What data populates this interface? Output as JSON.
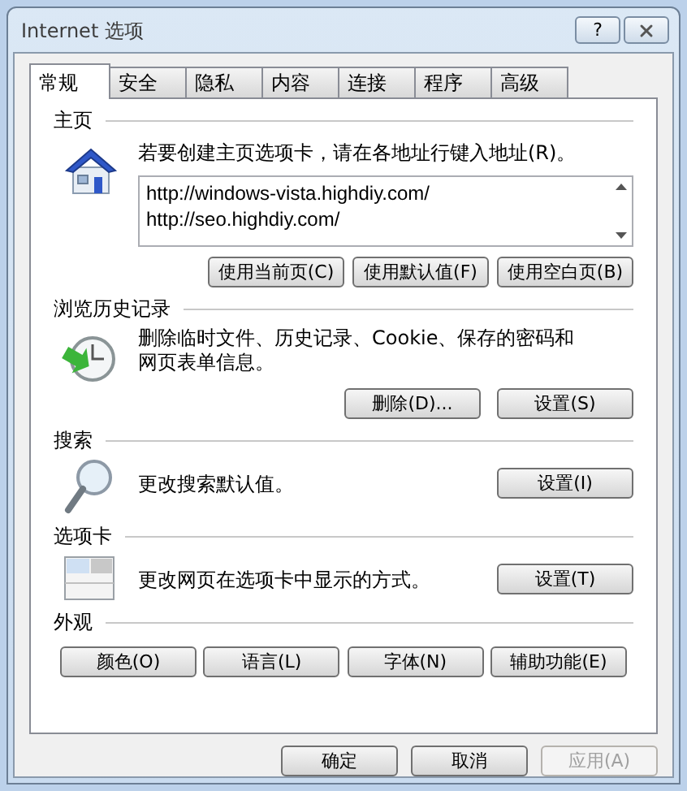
{
  "window": {
    "title": "Internet 选项",
    "help_button": "?"
  },
  "tabs": [
    {
      "label": "常规",
      "selected": true
    },
    {
      "label": "安全",
      "selected": false
    },
    {
      "label": "隐私",
      "selected": false
    },
    {
      "label": "内容",
      "selected": false
    },
    {
      "label": "连接",
      "selected": false
    },
    {
      "label": "程序",
      "selected": false
    },
    {
      "label": "高级",
      "selected": false
    }
  ],
  "sections": [
    {
      "kind": "home",
      "title": "主页",
      "description": "若要创建主页选项卡，请在各地址行键入地址(R)。",
      "urls": [
        "http://windows-vista.highdiy.com/",
        "http://seo.highdiy.com/"
      ],
      "buttons": [
        {
          "label": "使用当前页(C)",
          "disabled": false
        },
        {
          "label": "使用默认值(F)",
          "disabled": false
        },
        {
          "label": "使用空白页(B)",
          "disabled": false
        }
      ]
    },
    {
      "kind": "history",
      "title": "浏览历史记录",
      "description": "删除临时文件、历史记录、Cookie、保存的密码和网页表单信息。",
      "buttons": [
        {
          "label": "删除(D)...",
          "disabled": false
        },
        {
          "label": "设置(S)",
          "disabled": false
        }
      ]
    },
    {
      "kind": "search",
      "title": "搜索",
      "description": "更改搜索默认值。",
      "buttons": [
        {
          "label": "设置(I)",
          "disabled": false
        }
      ]
    },
    {
      "kind": "tabs",
      "title": "选项卡",
      "description": "更改网页在选项卡中显示的方式。",
      "buttons": [
        {
          "label": "设置(T)",
          "disabled": false
        }
      ]
    },
    {
      "kind": "appearance",
      "title": "外观",
      "buttons": [
        {
          "label": "颜色(O)",
          "disabled": false
        },
        {
          "label": "语言(L)",
          "disabled": false
        },
        {
          "label": "字体(N)",
          "disabled": false
        },
        {
          "label": "辅助功能(E)",
          "disabled": false
        }
      ]
    }
  ],
  "footer_buttons": [
    {
      "label": "确定",
      "disabled": false
    },
    {
      "label": "取消",
      "disabled": false
    },
    {
      "label": "应用(A)",
      "disabled": true
    }
  ]
}
